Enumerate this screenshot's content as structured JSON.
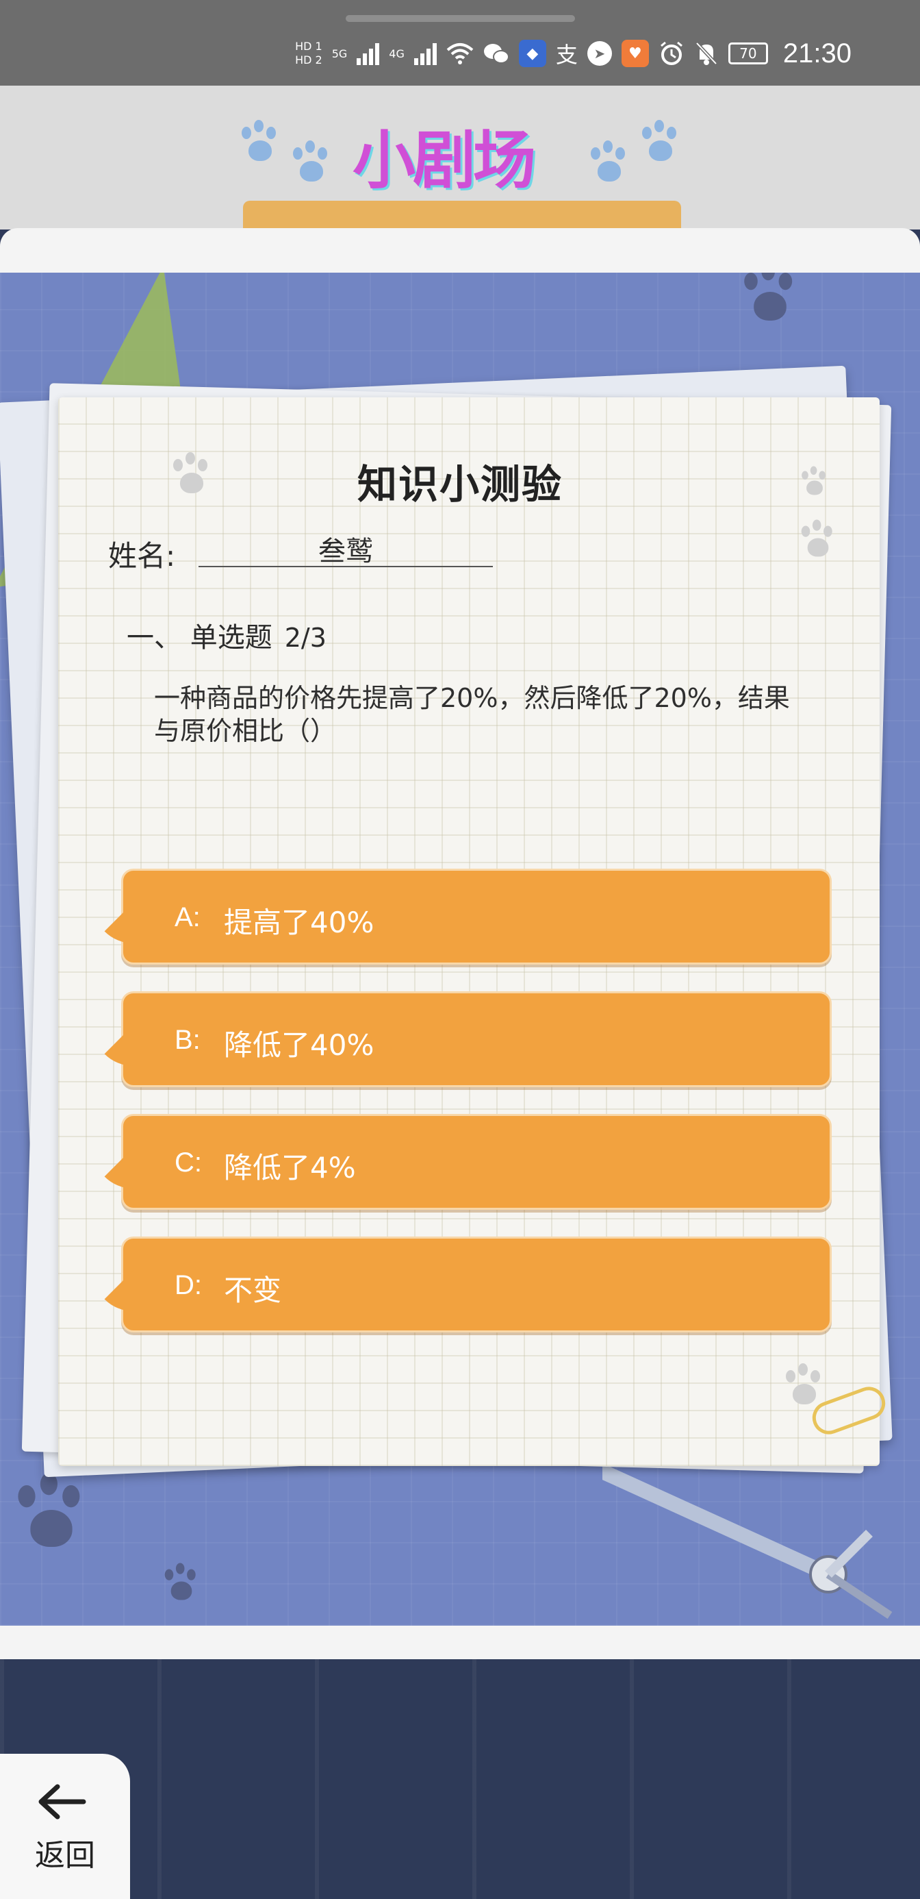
{
  "status_bar": {
    "hd1": "HD 1",
    "hd2": "HD 2",
    "net1": "5G",
    "net2": "4G",
    "battery": "70",
    "time": "21:30"
  },
  "banner": {
    "title": "小剧场"
  },
  "quiz": {
    "title": "知识小测验",
    "name_label": "姓名:",
    "name_value": "叁鹫",
    "section_label": "一、 单选题",
    "progress": "2/3",
    "question": "一种商品的价格先提高了20%，然后降低了20%，结果与原价相比（）",
    "options": [
      {
        "letter": "A:",
        "text": "提高了40%"
      },
      {
        "letter": "B:",
        "text": "降低了40%"
      },
      {
        "letter": "C:",
        "text": "降低了4%"
      },
      {
        "letter": "D:",
        "text": "不变"
      }
    ]
  },
  "nav": {
    "back_label": "返回"
  },
  "colors": {
    "option_fill": "#f2a23f",
    "scene_bg": "#7285c3",
    "status_bar": "#6d6d6d"
  }
}
